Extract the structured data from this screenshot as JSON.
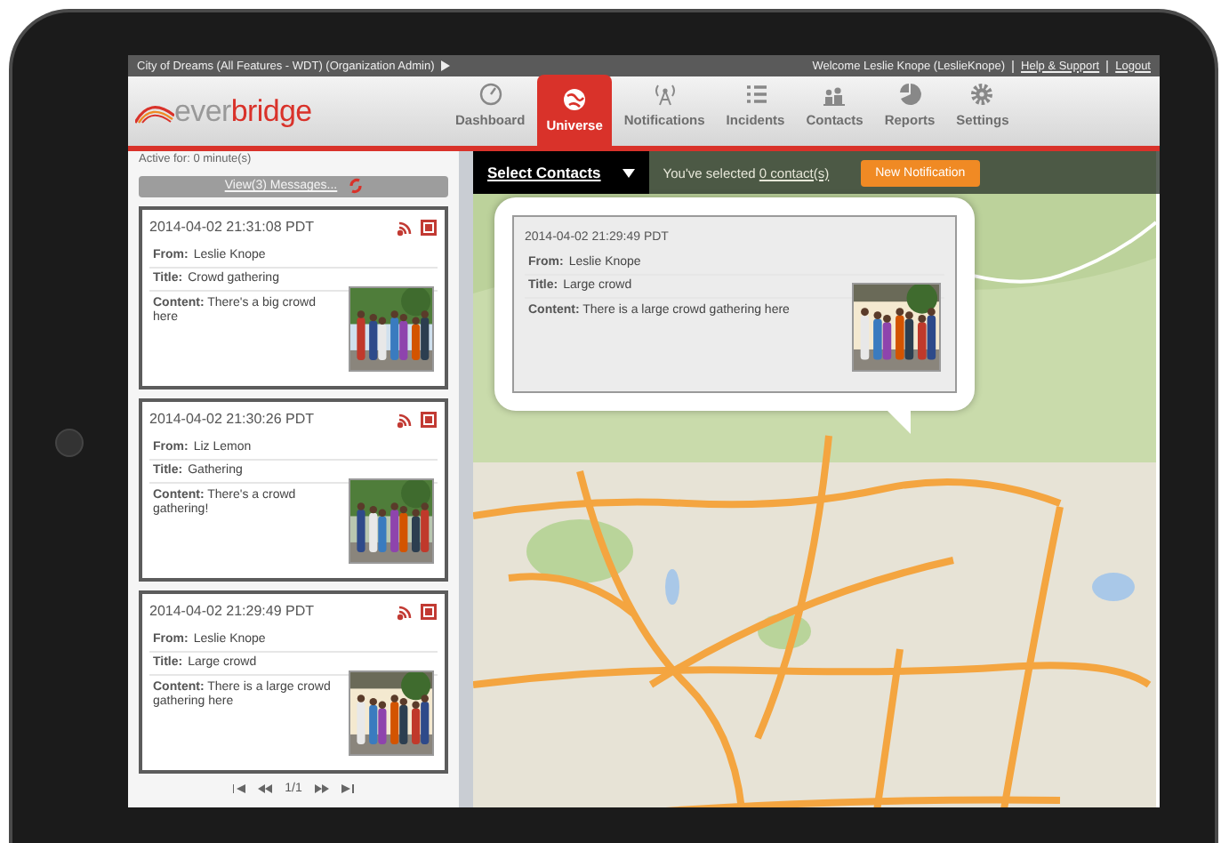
{
  "top_bar": {
    "organization": "City of Dreams (All Features - WDT) (Organization Admin)",
    "welcome": "Welcome Leslie Knope (LeslieKnope)",
    "links": [
      "Help & Support",
      "Logout"
    ]
  },
  "logo": {
    "part_1": "ever",
    "part_2": "bridge"
  },
  "nav": [
    {
      "label": "Dashboard",
      "selected": false
    },
    {
      "label": "Universe",
      "selected": true
    },
    {
      "label": "Notifications",
      "selected": false
    },
    {
      "label": "Incidents",
      "selected": false
    },
    {
      "label": "Contacts",
      "selected": false
    },
    {
      "label": "Reports",
      "selected": false
    },
    {
      "label": "Settings",
      "selected": false
    }
  ],
  "sidebar": {
    "active_for": "Active for: 0 minute(s)",
    "view_button": "View(3) Messages...",
    "messages": [
      {
        "time": "2014-04-02 21:31:08 PDT",
        "from_label": "From:",
        "from": "Leslie Knope",
        "title_label": "Title:",
        "title": "Crowd gathering",
        "content_label": "Content:",
        "content": "There's a big crowd here"
      },
      {
        "time": "2014-04-02 21:30:26 PDT",
        "from_label": "From:",
        "from": "Liz Lemon",
        "title_label": "Title:",
        "title": "Gathering",
        "content_label": "Content:",
        "content": "There's a crowd gathering!"
      },
      {
        "time": "2014-04-02 21:29:49 PDT",
        "from_label": "From:",
        "from": "Leslie Knope",
        "title_label": "Title:",
        "title": "Large crowd",
        "content_label": "Content:",
        "content": "There is a large crowd gathering here"
      }
    ],
    "pager": "1/1"
  },
  "map_toolbar": {
    "select_contacts": "Select Contacts",
    "selected_text": "You've selected",
    "contacts_link": "0 contact(s)",
    "new_button": "New Notification"
  },
  "popup": {
    "time": "2014-04-02 21:29:49 PDT",
    "from_label": "From:",
    "from": "Leslie Knope",
    "title_label": "Title:",
    "title": "Large crowd",
    "content_label": "Content:",
    "content": "There is a large crowd gathering here"
  }
}
